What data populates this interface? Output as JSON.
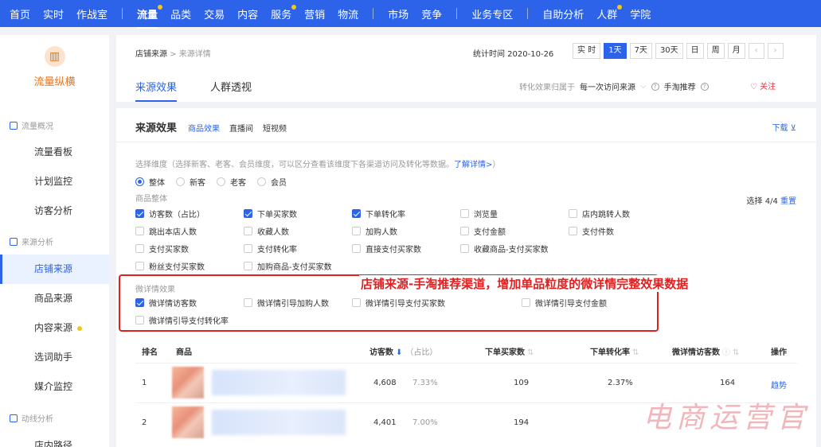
{
  "topnav": {
    "items": [
      "首页",
      "实时",
      "作战室",
      "流量",
      "品类",
      "交易",
      "内容",
      "服务",
      "营销",
      "物流",
      "市场",
      "竞争",
      "业务专区",
      "自助分析",
      "人群",
      "学院"
    ]
  },
  "sidebar": {
    "logo_label": "流量纵横",
    "logo_icon": "chart-logo-icon",
    "groups": [
      "流量概况",
      "来源分析",
      "动线分析"
    ],
    "items": [
      "流量看板",
      "计划监控",
      "访客分析",
      "店铺来源",
      "商品来源",
      "内容来源",
      "选词助手",
      "媒介监控",
      "店内路径"
    ]
  },
  "header": {
    "breadcrumb_root": "店铺来源",
    "breadcrumb_sep": ">",
    "breadcrumb_current": "来源详情",
    "stat_time": "统计时间 2020-10-26",
    "time_buttons": [
      "实 时",
      "1天",
      "7天",
      "30天",
      "日",
      "周",
      "月"
    ],
    "prev_arrow": "‹",
    "next_arrow": "›",
    "tabs": [
      "来源效果",
      "人群透视"
    ],
    "attr_label": "转化效果归属于",
    "attr_value": "每一次访问来源",
    "attr_channel": "手淘推荐",
    "follow": "♡ 关注"
  },
  "main": {
    "title": "来源效果",
    "sub_tabs": [
      "商品效果",
      "直播间",
      "短视频"
    ],
    "download": "下载 ⊻",
    "hint": "选择维度（选择新客、老客、会员维度，可以区分查看该维度下各渠道访问及转化等数据。",
    "hint_link": "了解详情>",
    "hint_end": "）",
    "radios": [
      "整体",
      "新客",
      "老客",
      "会员"
    ],
    "group1_label": "商品整体",
    "select_count": "选择 4/4",
    "reset": "重置",
    "metrics": [
      [
        "访客数（占比）",
        "下单买家数",
        "下单转化率",
        "浏览量",
        "店内跳转人数"
      ],
      [
        "跳出本店人数",
        "收藏人数",
        "加购人数",
        "支付金额",
        "支付件数"
      ],
      [
        "支付买家数",
        "支付转化率",
        "直接支付买家数",
        "收藏商品-支付买家数"
      ],
      [
        "粉丝支付买家数",
        "加购商品-支付买家数"
      ]
    ],
    "group2_label": "微详情效果",
    "micro_metrics": [
      "微详情访客数",
      "微详情引导加购人数",
      "微详情引导支付买家数",
      "微详情引导支付金额",
      "微详情引导支付转化率"
    ],
    "annotation": "店铺来源-手淘推荐渠道，增加单品粒度的微详情完整效果数据"
  },
  "table": {
    "headers": [
      "排名",
      "商品",
      "访客数",
      "（占比）",
      "下单买家数",
      "下单转化率",
      "微详情访客数",
      "操作"
    ],
    "rows": [
      {
        "rank": "1",
        "visitors": "4,608",
        "share": "7.33%",
        "buyers": "109",
        "rate": "2.37%",
        "micro": "164",
        "action": "趋势"
      },
      {
        "rank": "2",
        "visitors": "4,401",
        "share": "7.00%",
        "buyers": "194",
        "rate": "",
        "micro": "",
        "action": ""
      }
    ]
  },
  "watermark": "电商运营官",
  "colors": {
    "brand": "#2c63e8",
    "accent_orange": "#e8751a",
    "annotation_red": "#e02020",
    "badge_yellow": "#f5c518"
  }
}
